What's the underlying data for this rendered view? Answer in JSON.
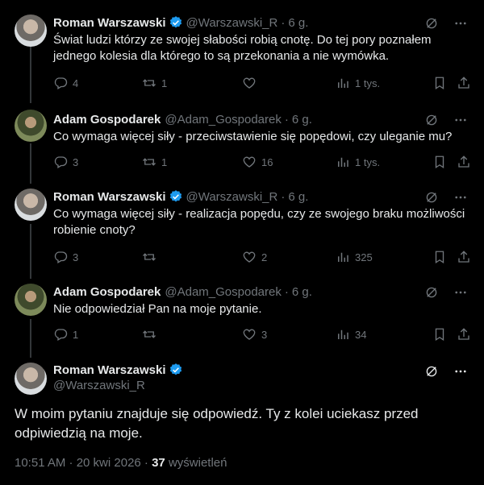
{
  "tweets": [
    {
      "name": "Roman Warszawski",
      "handle": "@Warszawski_R",
      "time": "6 g.",
      "text": "Świat ludzi którzy ze swojej słabości robią cnotę. Do tej pory poznałem jednego kolesia dla którego to są przekonania a nie wymówka.",
      "replies": "4",
      "reposts": "1",
      "likes": "",
      "views": "1 tys."
    },
    {
      "name": "Adam Gospodarek",
      "handle": "@Adam_Gospodarek",
      "time": "6 g.",
      "text": "Co wymaga więcej siły - przeciwstawienie się popędowi, czy uleganie mu?",
      "replies": "3",
      "reposts": "1",
      "likes": "16",
      "views": "1 tys."
    },
    {
      "name": "Roman Warszawski",
      "handle": "@Warszawski_R",
      "time": "6 g.",
      "text": "Co wymaga więcej siły - realizacja popędu, czy ze swojego braku możliwości robienie cnoty?",
      "replies": "3",
      "reposts": "",
      "likes": "2",
      "views": "325"
    },
    {
      "name": "Adam Gospodarek",
      "handle": "@Adam_Gospodarek",
      "time": "6 g.",
      "text": "Nie odpowiedział Pan na moje pytanie.",
      "replies": "1",
      "reposts": "",
      "likes": "3",
      "views": "34"
    }
  ],
  "main": {
    "name": "Roman Warszawski",
    "handle": "@Warszawski_R",
    "text": "W moim pytaniu znajduje się odpowiedź. Ty z kolei uciekasz przed odpiwiedzią na moje.",
    "timestamp": "10:51 AM · 20 kwi 2026 · ",
    "views_count": "37",
    "views_label": "wyświetleń"
  },
  "colors": {
    "background": "#000000",
    "text": "#e7e9ea",
    "muted": "#71767b",
    "verified": "#1d9bf0"
  },
  "icons": [
    "grok-icon",
    "more-icon",
    "reply-icon",
    "repost-icon",
    "like-icon",
    "views-icon",
    "bookmark-icon",
    "share-icon",
    "verified-icon"
  ]
}
